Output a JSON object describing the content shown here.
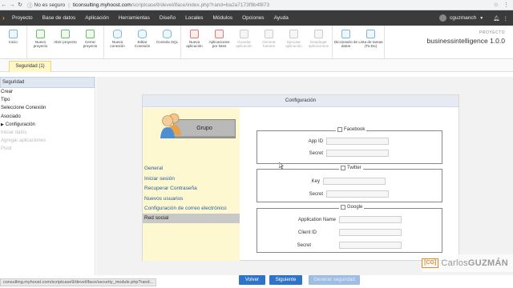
{
  "browser": {
    "secure_label": "No es seguro",
    "url_host": "ticonsulting.myhoost.com",
    "url_path": "/scriptcase9/devel/iface/index.php?rand=ba2a7173f9b4f873"
  },
  "menubar": {
    "items": [
      "Proyecto",
      "Base de datos",
      "Aplicación",
      "Herramientas",
      "Diseño",
      "Locales",
      "Módulos",
      "Opciones",
      "Ayuda"
    ],
    "username": "cguzmanch"
  },
  "toolbar": {
    "buttons": [
      {
        "label": "Inicio"
      },
      {
        "label": "Nuevo proyecto"
      },
      {
        "label": "Abrir proyecto"
      },
      {
        "label": "Cerrar proyecto"
      },
      {
        "label": "Nueva conexión"
      },
      {
        "label": "Editar Conexión"
      },
      {
        "label": "Consola SQL"
      },
      {
        "label": "Nueva aplicación"
      },
      {
        "label": "Aplicaciones por lotes"
      },
      {
        "label": "Guardar aplicación"
      },
      {
        "label": "Generar fuentes"
      },
      {
        "label": "Ejecutar aplicación"
      },
      {
        "label": "Desplegar aplicaciones"
      },
      {
        "label": "Diccionario de datos"
      },
      {
        "label": "Lista de tareas (To-Do)"
      }
    ],
    "project_caption": "PROYECTO",
    "project_name": "businessintelligence 1.0.0"
  },
  "tabs": {
    "active": "Seguridad (1)"
  },
  "sidebar": {
    "header": "Seguridad",
    "items": [
      "Crear",
      "Tipo",
      "Seleccione Conexión",
      "Asociado",
      "Configuración",
      "Iniciar datos",
      "Agregar aplicaciones",
      "Postr"
    ]
  },
  "panel": {
    "title": "Configuración",
    "group_button": "Grupo",
    "menu": [
      "General",
      "Iniciar sesión",
      "Recuperar Contraseña",
      "Nuevos usuarios",
      "Configuración de correo electrónico",
      "Red social"
    ],
    "facebook": {
      "legend": "Facebook",
      "app_id_label": "App ID",
      "secret_label": "Secret"
    },
    "twitter": {
      "legend": "Twitter",
      "key_label": "Key",
      "secret_label": "Secret"
    },
    "google": {
      "legend": "Google",
      "app_name_label": "Application Name",
      "client_id_label": "Client ID",
      "secret_label": "Secret"
    }
  },
  "footer": {
    "back_label": "Volver",
    "next_label": "Siguiente",
    "generate_label": "Generar seguridad",
    "status_url": "consulting.myhoost.com/scriptcase9/devel/iface/security_module.php?rand..."
  },
  "watermark": {
    "box": "[CG]",
    "first": "Carlos",
    "last": "GUZMÁN"
  },
  "colors": {
    "accent": "#2f74c7",
    "menubar": "#3b3b3b",
    "tab_active": "#fff7c8",
    "left_column": "#fdf8d0"
  }
}
